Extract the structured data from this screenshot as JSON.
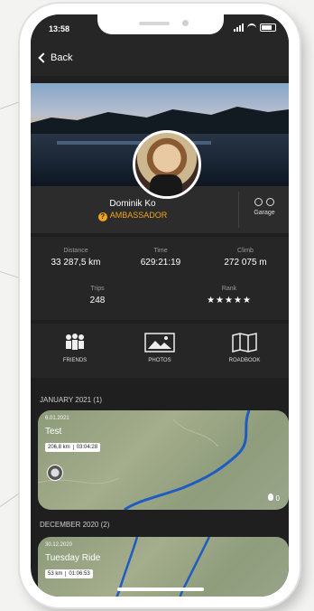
{
  "status": {
    "time": "13:58"
  },
  "nav": {
    "back_label": "Back"
  },
  "profile": {
    "name": "Dominik Ko",
    "badge": "AMBASSADOR",
    "garage_label": "Garage"
  },
  "stats": {
    "distance": {
      "label": "Distance",
      "value": "33 287,5 km"
    },
    "time": {
      "label": "Time",
      "value": "629:21:19"
    },
    "climb": {
      "label": "Climb",
      "value": "272 075 m"
    },
    "trips": {
      "label": "Trips",
      "value": "248"
    },
    "rank": {
      "label": "Rank",
      "stars": "★★★★★"
    }
  },
  "actions": [
    {
      "label": "FRIENDS",
      "icon": "friends-icon"
    },
    {
      "label": "PHOTOS",
      "icon": "photos-icon"
    },
    {
      "label": "ROADBOOK",
      "icon": "roadbook-icon"
    }
  ],
  "sections": [
    {
      "header": "JANUARY 2021 (1)",
      "trips": [
        {
          "date": "6.01.2021",
          "title": "Test",
          "distance": "206,8 km",
          "duration": "03:04:28",
          "likes": "0"
        }
      ]
    },
    {
      "header": "DECEMBER 2020 (2)",
      "trips": [
        {
          "date": "30.12.2020",
          "title": "Tuesday Ride",
          "distance": "53 km",
          "duration": "01:06:53"
        }
      ]
    }
  ],
  "colors": {
    "accent": "#f2a51c",
    "background": "#1f1f1f",
    "route": "#1e5bc2",
    "star": "#f5c21a"
  }
}
